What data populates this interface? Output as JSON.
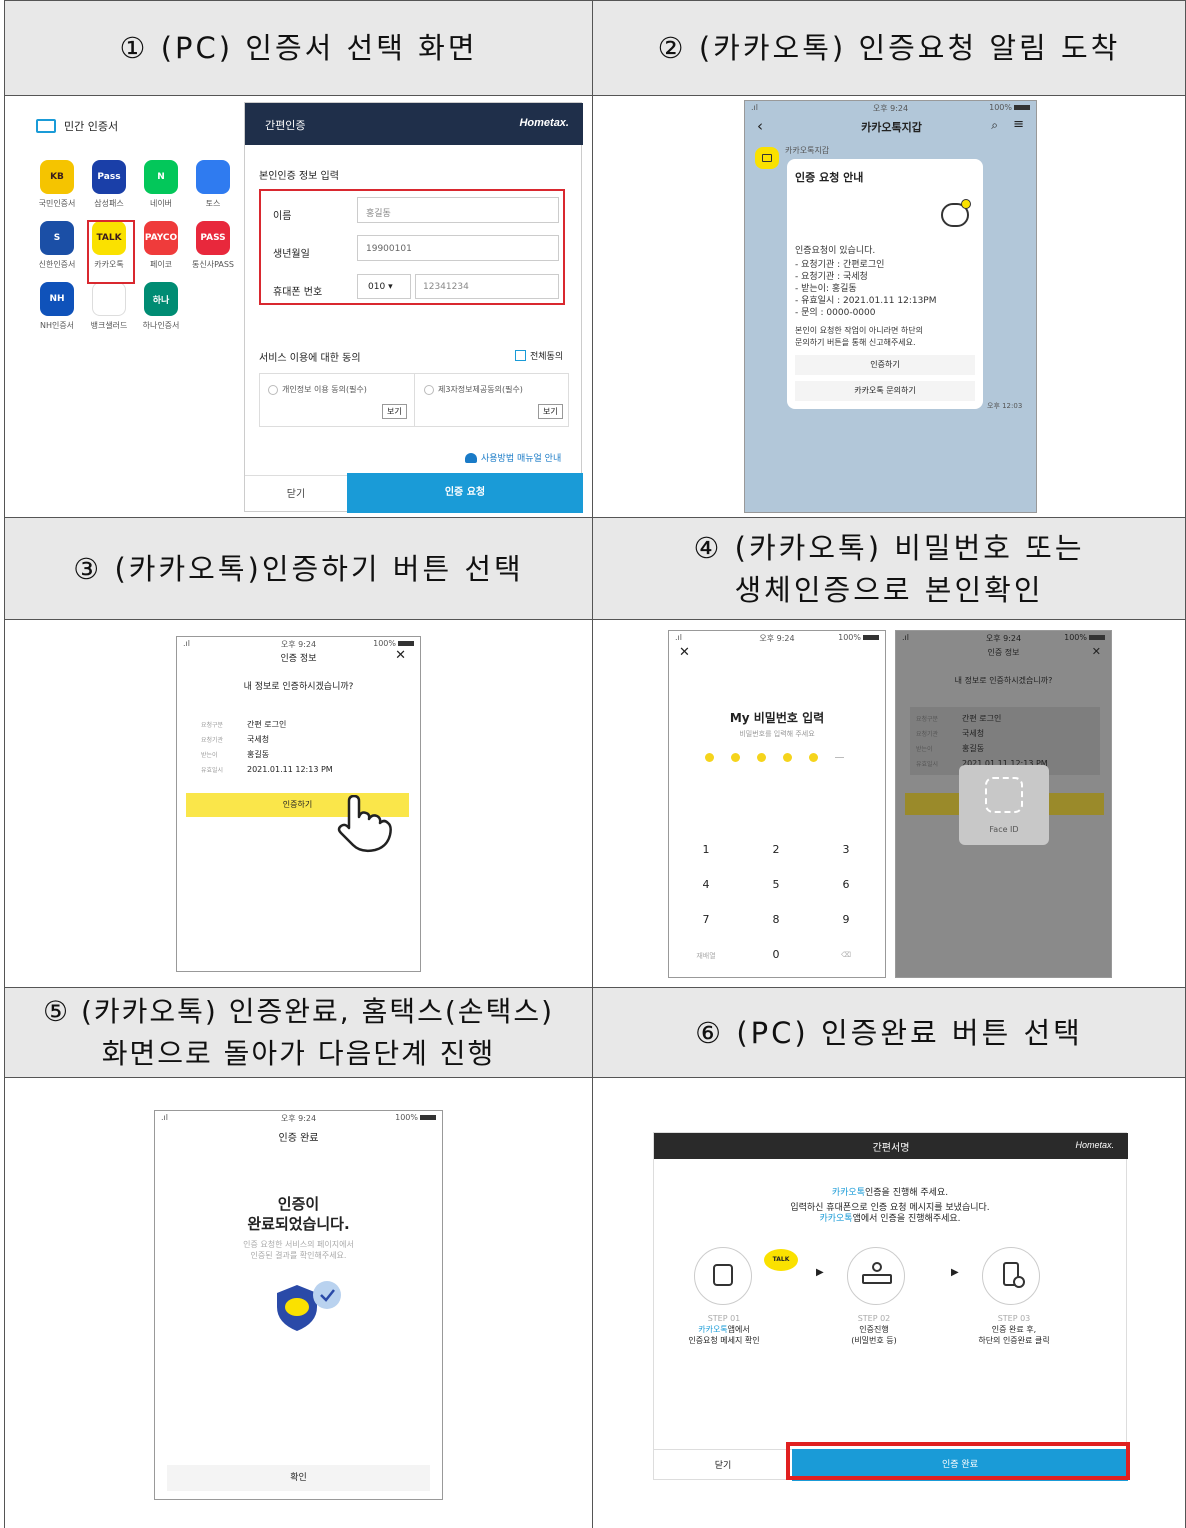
{
  "headers": {
    "h1": "① (PC) 인증서 선택 화면",
    "h2": "② (카카오톡) 인증요청 알림 도착",
    "h3": "③ (카카오톡)인증하기 버튼 선택",
    "h4a": "④ (카카오톡) 비밀번호 또는",
    "h4b": "생체인증으로 본인확인",
    "h5a": "⑤ (카카오톡) 인증완료, 홈택스(손택스)",
    "h5b": "화면으로 돌아가 다음단계 진행",
    "h6": "⑥ (PC) 인증완료 버튼 선택"
  },
  "p1": {
    "title": "민간 인증서",
    "apps": [
      {
        "label": "국민인증서",
        "icon": "KB",
        "color": "#f5c400"
      },
      {
        "label": "삼성패스",
        "icon": "Pass",
        "color": "#1a3fa8"
      },
      {
        "label": "네이버",
        "icon": "N",
        "color": "#03c75a"
      },
      {
        "label": "토스",
        "icon": "",
        "color": "#2f7bf0"
      },
      {
        "label": "신한인증서",
        "icon": "S",
        "color": "#1b4fa6"
      },
      {
        "label": "카카오톡",
        "icon": "TALK",
        "color": "#fae100"
      },
      {
        "label": "페이코",
        "icon": "PAYCO",
        "color": "#ef3b3b"
      },
      {
        "label": "통신사PASS",
        "icon": "PASS",
        "color": "#e8283c"
      },
      {
        "label": "NH인증서",
        "icon": "NH",
        "color": "#0f52ba"
      },
      {
        "label": "뱅크샐러드",
        "icon": "",
        "color": "#ffffff"
      },
      {
        "label": "하나인증서",
        "icon": "하나",
        "color": "#008c73"
      }
    ],
    "dialog_title": "간편인증",
    "logo": "Hometax.",
    "section": "본인인증 정보 입력",
    "name_label": "이름",
    "name_value": "홍길동",
    "birth_label": "생년월일",
    "birth_value": "19900101",
    "phone_label": "휴대폰 번호",
    "phone_prefix": "010",
    "phone_value": "12341234",
    "consent_title": "서비스 이용에 대한 동의",
    "consent_all": "전체동의",
    "consent1": "개인정보 이용 동의(필수)",
    "consent2": "제3자정보제공동의(필수)",
    "view": "보기",
    "manual": "사용방법 매뉴얼 안내",
    "close": "닫기",
    "request": "인증 요청"
  },
  "p2": {
    "time": "오후 9:24",
    "battery": "100%",
    "title": "카카오톡지갑",
    "sender": "카카오톡지갑",
    "card_title": "인증 요청 안내",
    "msg": "인증요청이 있습니다.",
    "details": [
      "- 요청기관 : 간편로그인",
      "- 요청기관 : 국세청",
      "- 받는이: 홍길동",
      "- 유효일시 : 2021.01.11 12:13PM",
      "- 문의 : 0000-0000"
    ],
    "note1": "본인이 요청한 작업이 아니라면 하단의",
    "note2": "문의하기 버튼을 통해 신고해주세요.",
    "btn1": "인증하기",
    "btn2": "카카오톡 문의하기",
    "stamp": "오후 12:03"
  },
  "p3": {
    "time": "오후 9:24",
    "battery": "100%",
    "title": "인증 정보",
    "question": "내 정보로 인증하시겠습니까?",
    "rows": [
      {
        "k": "요청구분",
        "v": "간편 로그인"
      },
      {
        "k": "요청기관",
        "v": "국세청"
      },
      {
        "k": "받는이",
        "v": "홍길동"
      },
      {
        "k": "유효일시",
        "v": "2021.01.11 12:13 PM"
      }
    ],
    "button": "인증하기"
  },
  "p4": {
    "time": "오후 9:24",
    "battery": "100%",
    "pw_title": "My 비밀번호 입력",
    "pw_sub": "비밀번호를 입력해 주세요",
    "keys": [
      "1",
      "2",
      "3",
      "4",
      "5",
      "6",
      "7",
      "8",
      "9",
      "재배열",
      "0",
      "⌫"
    ],
    "faceid": "Face ID"
  },
  "p5": {
    "time": "오후 9:24",
    "battery": "100%",
    "title": "인증 완료",
    "big1": "인증이",
    "big2": "완료되었습니다.",
    "sub1": "인증 요청한 서비스의 페이지에서",
    "sub2": "인증된 결과를 확인해주세요.",
    "confirm": "확인"
  },
  "p6": {
    "header": "간편서명",
    "logo": "Hometax.",
    "kakao": "카카오톡",
    "line1": "인증을 진행해 주세요.",
    "line2": "입력하신 휴대폰으로 인증 요청 메시지를 보냈습니다.",
    "line3": "앱에서 인증을 진행해주세요.",
    "steps": [
      {
        "step": "STEP 01",
        "a": "카카오톡",
        "b": "앱에서",
        "c": "인증요청 메세지 확인"
      },
      {
        "step": "STEP 02",
        "a": "",
        "b": "인증진행",
        "c": "(비밀번호 등)"
      },
      {
        "step": "STEP 03",
        "a": "",
        "b": "인증 완료 후,",
        "c": "하단의 인증완료 클릭"
      }
    ],
    "close": "닫기",
    "complete": "인증 완료"
  },
  "colors": {
    "accent": "#1a9bd7",
    "kakao": "#fae100",
    "highlight": "#e02020"
  }
}
